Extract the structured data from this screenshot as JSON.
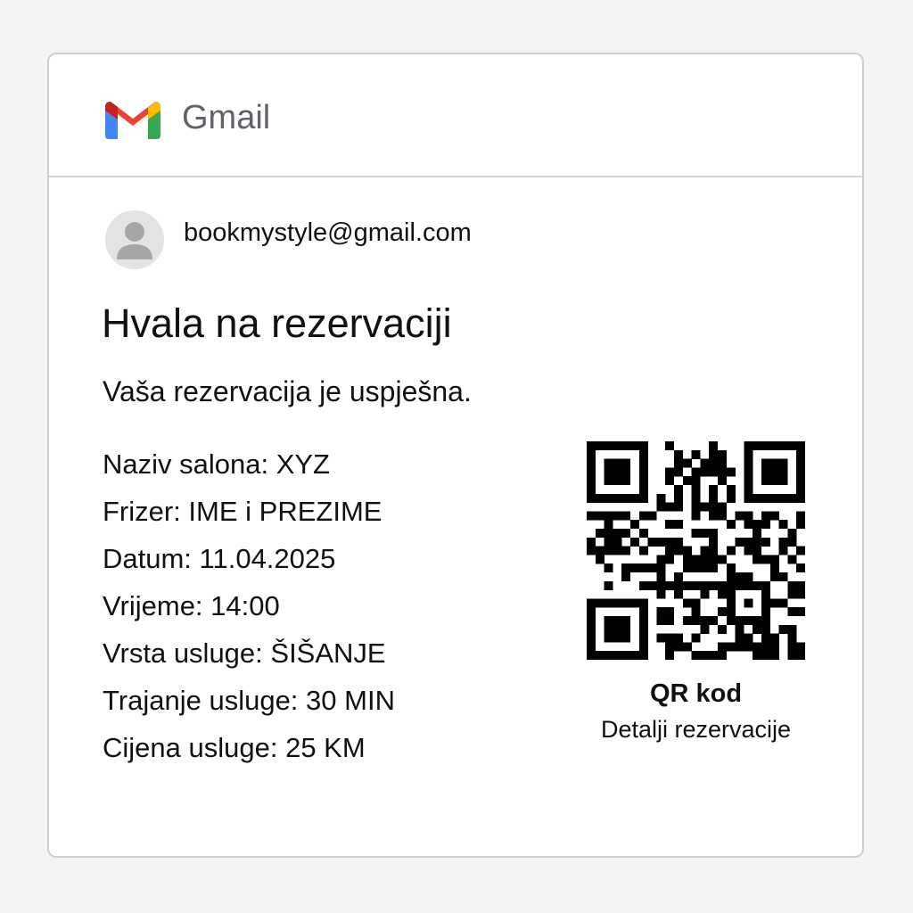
{
  "header": {
    "app_name": "Gmail",
    "logo_icon": "gmail-m-logo-icon",
    "logo_colors": {
      "red": "#EA4335",
      "yellow": "#FBBC04",
      "green": "#34A853",
      "blue": "#4285F4"
    }
  },
  "email": {
    "sender": "bookmystyle@gmail.com",
    "avatar_icon": "person-icon",
    "title": "Hvala na rezervaciji",
    "subtitle": "Vaša rezervacija je uspješna.",
    "details": [
      "Naziv salona: XYZ",
      "Frizer: IME i PREZIME",
      "Datum: 11.04.2025",
      "Vrijeme: 14:00",
      "Vrsta usluge: ŠIŠANJE",
      "Trajanje usluge: 30 MIN",
      "Cijena usluge: 25 KM"
    ]
  },
  "qr": {
    "icon": "qr-code-icon",
    "title": "QR kod",
    "caption": "Detalji rezervacije"
  }
}
